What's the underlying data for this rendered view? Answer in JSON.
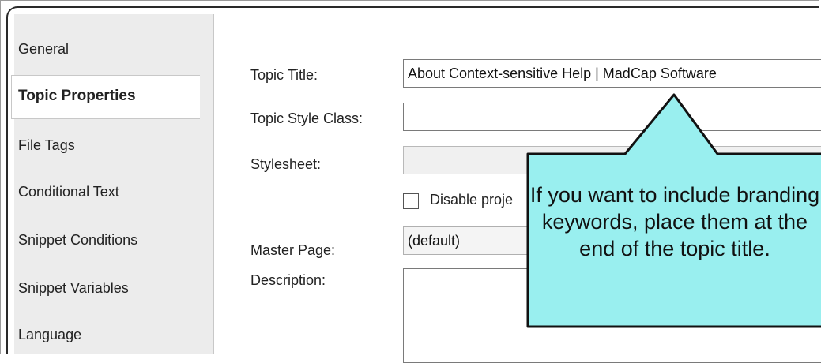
{
  "sidebar": {
    "items": [
      {
        "label": "General",
        "active": false
      },
      {
        "label": "Topic Properties",
        "active": true
      },
      {
        "label": "File Tags",
        "active": false
      },
      {
        "label": "Conditional Text",
        "active": false
      },
      {
        "label": "Snippet Conditions",
        "active": false
      },
      {
        "label": "Snippet Variables",
        "active": false
      },
      {
        "label": "Language",
        "active": false
      }
    ]
  },
  "form": {
    "topic_title_label": "Topic Title:",
    "topic_title_value": "About Context-sensitive Help | MadCap Software",
    "topic_style_class_label": "Topic Style Class:",
    "topic_style_class_value": "",
    "stylesheet_label": "Stylesheet:",
    "stylesheet_value": "",
    "disable_checkbox_label": "Disable proje",
    "master_page_label": "Master Page:",
    "master_page_value": "(default)",
    "description_label": "Description:",
    "description_value": ""
  },
  "callout": {
    "text": "If you want to include branding keywords, place them at the end of the topic title.",
    "fill_color": "#99efef",
    "stroke_color": "#111111"
  }
}
